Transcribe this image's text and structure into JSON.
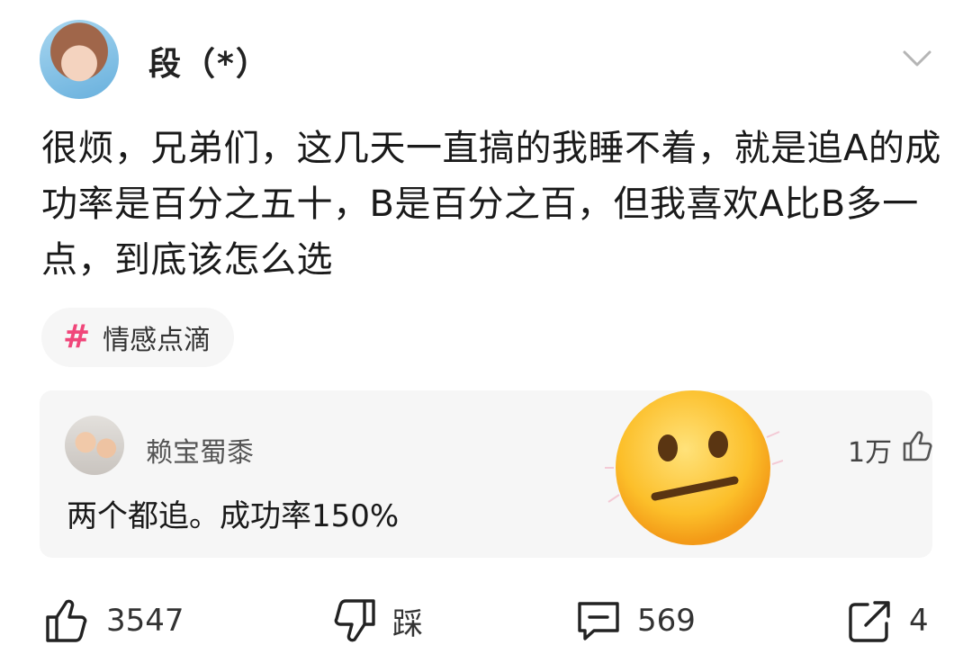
{
  "post": {
    "author": "段（*）",
    "text": "很烦，兄弟们，这几天一直搞的我睡不着，就是追A的成功率是百分之五十，B是百分之百，但我喜欢A比B多一点，到底该怎么选",
    "tag": "情感点滴"
  },
  "hot_comment": {
    "user": "赖宝蜀黍",
    "text": "两个都追。成功率150%",
    "likes": "1万"
  },
  "actions": {
    "like_count": "3547",
    "dislike_label": "踩",
    "comment_count": "569",
    "share_count": "4"
  },
  "colors": {
    "tag_hash": "#f0467a",
    "card_bg": "#f6f6f6"
  }
}
